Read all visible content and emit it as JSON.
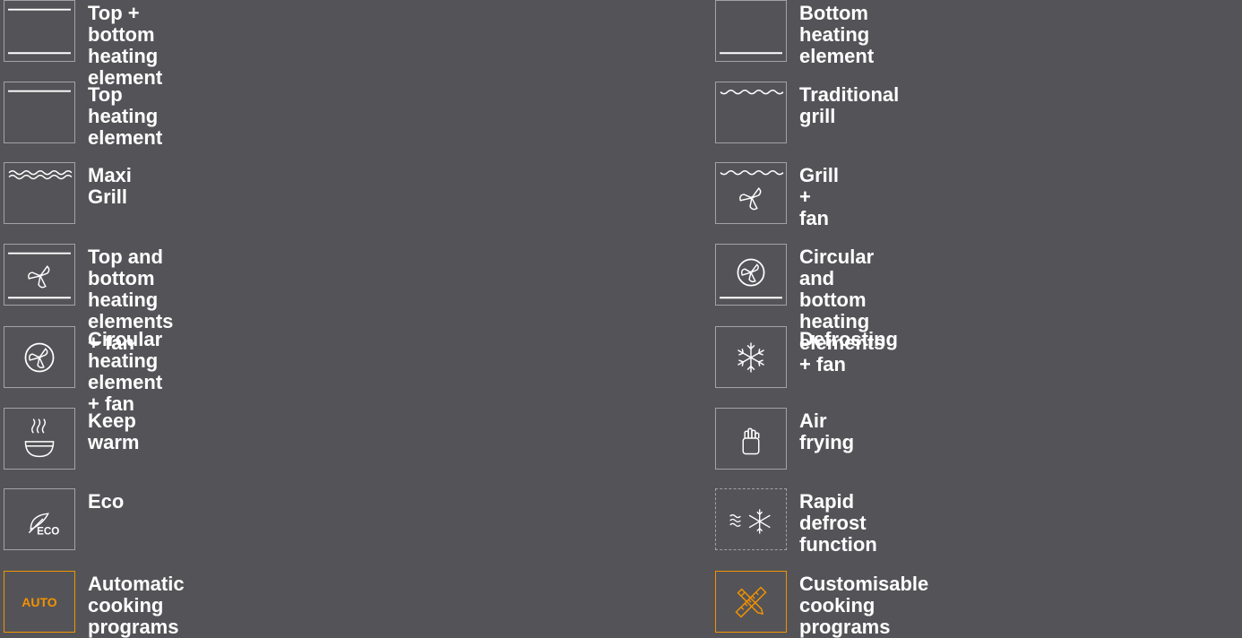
{
  "left_items": [
    {
      "label": "Top + bottom heating element",
      "icon": "top-bottom-heat-icon"
    },
    {
      "label": "Top heating element",
      "icon": "top-heat-icon"
    },
    {
      "label": "Maxi Grill",
      "icon": "maxi-grill-icon"
    },
    {
      "label": "Top and bottom heating elements + fan",
      "icon": "top-bottom-fan-icon"
    },
    {
      "label": "Circular heating element + fan",
      "icon": "circular-fan-icon"
    },
    {
      "label": "Keep warm",
      "icon": "keep-warm-icon"
    },
    {
      "label": "Eco",
      "icon": "eco-icon"
    },
    {
      "label": "Automatic cooking programs",
      "icon": "auto-icon",
      "icon_text": "AUTO"
    }
  ],
  "right_items": [
    {
      "label": "Bottom heating element",
      "icon": "bottom-heat-icon"
    },
    {
      "label": "Traditional grill",
      "icon": "traditional-grill-icon"
    },
    {
      "label": "Grill + fan",
      "icon": "grill-fan-icon"
    },
    {
      "label": "Circular and bottom heating elements + fan",
      "icon": "circular-bottom-fan-icon"
    },
    {
      "label": "Defrosting",
      "icon": "snowflake-icon"
    },
    {
      "label": "Air frying",
      "icon": "air-fry-icon"
    },
    {
      "label": "Rapid defrost function",
      "icon": "rapid-defrost-icon"
    },
    {
      "label": "Customisable cooking programs",
      "icon": "custom-programs-icon"
    }
  ],
  "colors": {
    "background": "#545458",
    "text": "#ffffff",
    "icon_line": "#ffffff",
    "icon_border": "#a3a3a7",
    "accent": "#f39200"
  }
}
